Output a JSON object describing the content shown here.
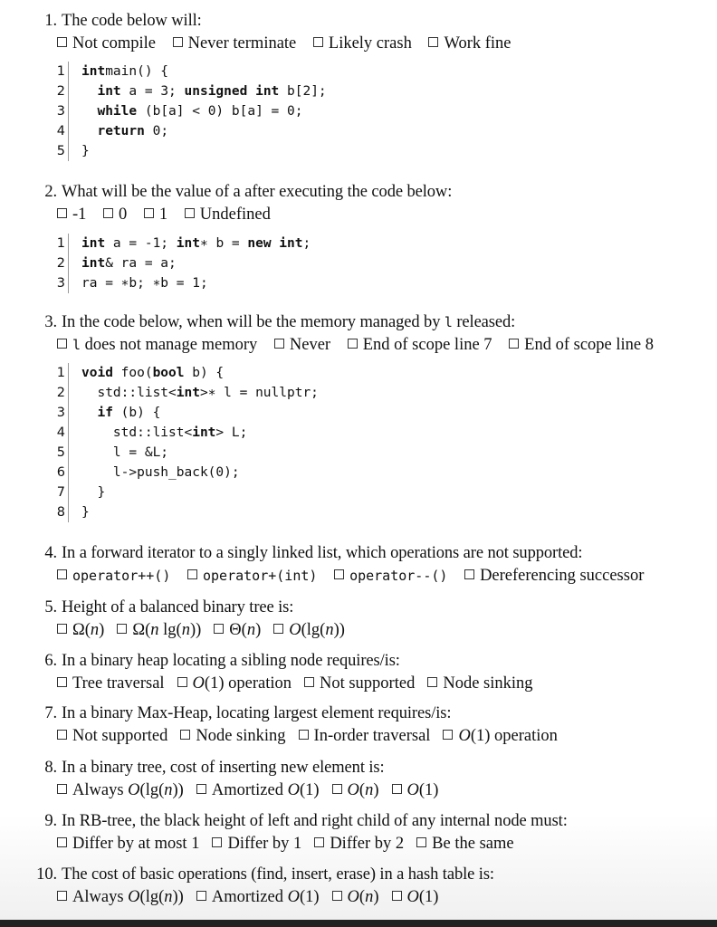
{
  "questions": [
    {
      "number": "1.",
      "text": "The code below will:",
      "options": [
        "Not compile",
        "Never terminate",
        "Likely crash",
        "Work fine"
      ],
      "code": [
        {
          "ln": "1",
          "parts": [
            [
              "kw",
              "int"
            ],
            [
              "",
              "main() {"
            ]
          ]
        },
        {
          "ln": "2",
          "parts": [
            [
              "",
              "  "
            ],
            [
              "kw",
              "int"
            ],
            [
              "",
              " a = 3; "
            ],
            [
              "kw",
              "unsigned int"
            ],
            [
              "",
              " b[2];"
            ]
          ]
        },
        {
          "ln": "3",
          "parts": [
            [
              "",
              "  "
            ],
            [
              "kw",
              "while"
            ],
            [
              "",
              " (b[a] < 0) b[a] = 0;"
            ]
          ]
        },
        {
          "ln": "4",
          "parts": [
            [
              "",
              "  "
            ],
            [
              "kw",
              "return"
            ],
            [
              "",
              " 0;"
            ]
          ]
        },
        {
          "ln": "5",
          "parts": [
            [
              "",
              "}"
            ]
          ]
        }
      ]
    },
    {
      "number": "2.",
      "text": "What will be the value of a after executing the code below:",
      "options": [
        "-1",
        "0",
        "1",
        "Undefined"
      ],
      "code": [
        {
          "ln": "1",
          "parts": [
            [
              "kw",
              "int"
            ],
            [
              "",
              " a = -1; "
            ],
            [
              "kw",
              "int"
            ],
            [
              "",
              "∗ b = "
            ],
            [
              "kw",
              "new int"
            ],
            [
              "",
              ";"
            ]
          ]
        },
        {
          "ln": "2",
          "parts": [
            [
              "kw",
              "int"
            ],
            [
              "",
              "& ra = a;"
            ]
          ]
        },
        {
          "ln": "3",
          "parts": [
            [
              "",
              "ra = ∗b; ∗b = 1;"
            ]
          ]
        }
      ]
    },
    {
      "number": "3.",
      "text_before": "In the code below, when will be the memory managed by ",
      "text_code": "l",
      "text_after": " released:",
      "options_rich": [
        {
          "code": "l",
          "text": " does not manage memory"
        },
        {
          "code": "",
          "text": "Never"
        },
        {
          "code": "",
          "text": "End of scope line 7"
        },
        {
          "code": "",
          "text": "End of scope line 8"
        }
      ],
      "code": [
        {
          "ln": "1",
          "parts": [
            [
              "kw",
              "void"
            ],
            [
              "",
              " foo("
            ],
            [
              "kw",
              "bool"
            ],
            [
              "",
              " b) {"
            ]
          ]
        },
        {
          "ln": "2",
          "parts": [
            [
              "",
              "  std::list<"
            ],
            [
              "kw",
              "int"
            ],
            [
              "",
              ">∗ l = nullptr;"
            ]
          ]
        },
        {
          "ln": "3",
          "parts": [
            [
              "",
              "  "
            ],
            [
              "kw",
              "if"
            ],
            [
              "",
              " (b) {"
            ]
          ]
        },
        {
          "ln": "4",
          "parts": [
            [
              "",
              "    std::list<"
            ],
            [
              "kw",
              "int"
            ],
            [
              "",
              "> L;"
            ]
          ]
        },
        {
          "ln": "5",
          "parts": [
            [
              "",
              "    l = &L;"
            ]
          ]
        },
        {
          "ln": "6",
          "parts": [
            [
              "",
              "    l->push_back(0);"
            ]
          ]
        },
        {
          "ln": "7",
          "parts": [
            [
              "",
              "  }"
            ]
          ]
        },
        {
          "ln": "8",
          "parts": [
            [
              "",
              "}"
            ]
          ]
        }
      ]
    },
    {
      "number": "4.",
      "text": "In a forward iterator to a singly linked list, which operations are not supported:",
      "options_mono": [
        "operator++()",
        "operator+(int)",
        "operator--()"
      ],
      "option_last": "Dereferencing successor"
    },
    {
      "number": "5.",
      "text": "Height of a balanced binary tree is:",
      "options": [
        "Ω(n)",
        "Ω(n lg(n))",
        "Θ(n)",
        "O(lg(n))"
      ]
    },
    {
      "number": "6.",
      "text": "In a binary heap locating a sibling node requires/is:",
      "options": [
        "Tree traversal",
        "O(1) operation",
        "Not supported",
        "Node sinking"
      ]
    },
    {
      "number": "7.",
      "text": "In a binary Max-Heap, locating largest element requires/is:",
      "options": [
        "Not supported",
        "Node sinking",
        "In-order traversal",
        "O(1) operation"
      ]
    },
    {
      "number": "8.",
      "text": "In a binary tree, cost of inserting new element is:",
      "options": [
        "Always O(lg(n))",
        "Amortized O(1)",
        "O(n)",
        "O(1)"
      ]
    },
    {
      "number": "9.",
      "text": "In RB-tree, the black height of left and right child of any internal node must:",
      "options": [
        "Differ by at most 1",
        "Differ by 1",
        "Differ by 2",
        "Be the same"
      ]
    },
    {
      "number": "10.",
      "text": "The cost of basic operations (find, insert, erase) in a hash table is:",
      "options": [
        "Always O(lg(n))",
        "Amortized O(1)",
        "O(n)",
        "O(1)"
      ]
    }
  ]
}
